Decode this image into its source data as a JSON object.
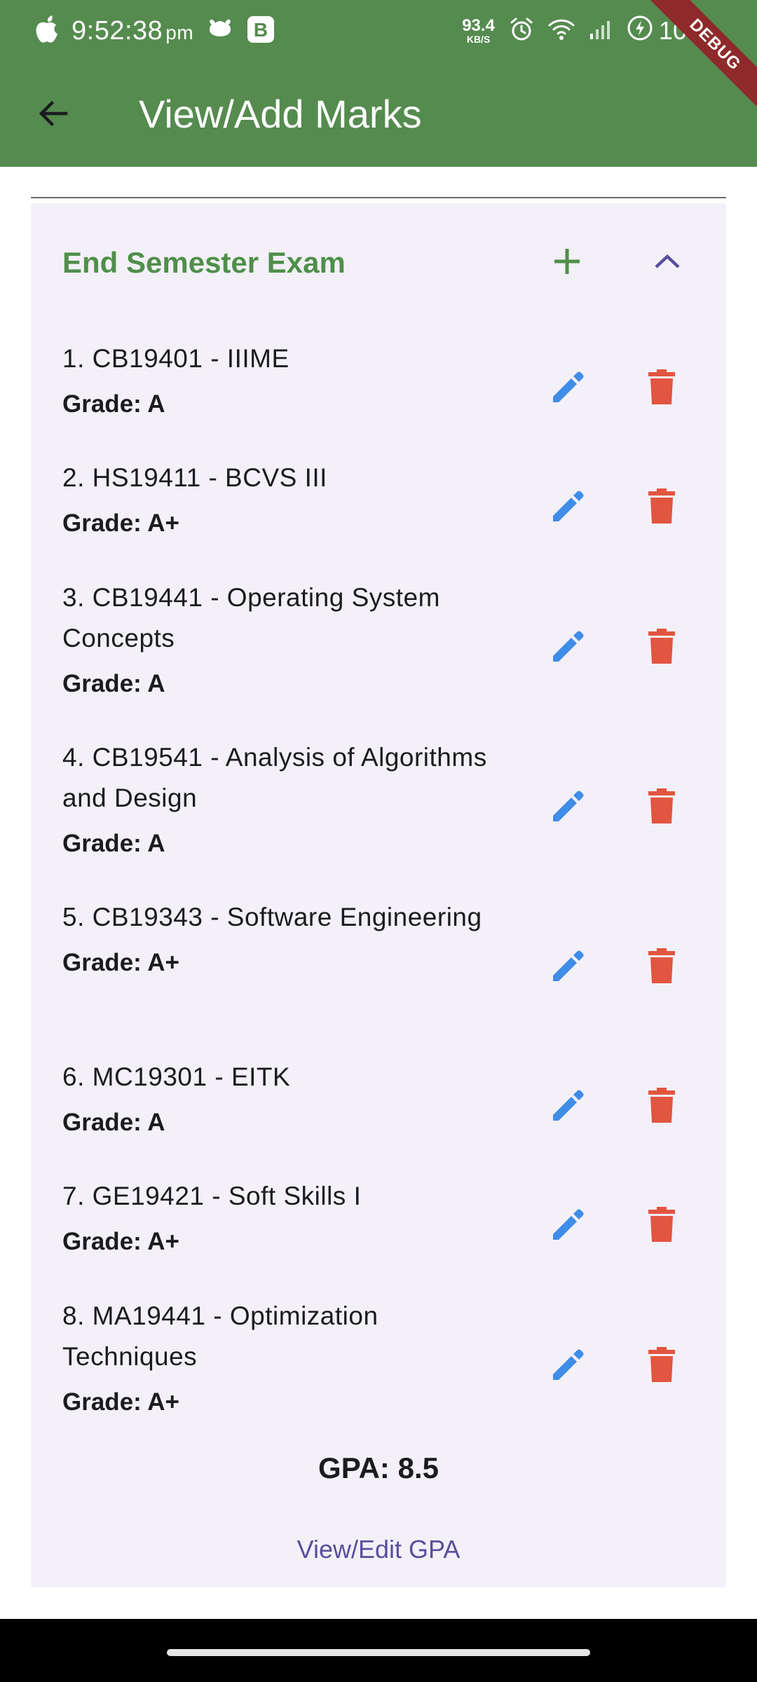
{
  "status_bar": {
    "time": "9:52:38",
    "ampm": "pm",
    "speed_value": "93.4",
    "speed_unit": "KB/S",
    "battery": "100",
    "debug_label": "DEBUG"
  },
  "app_bar": {
    "title": "View/Add Marks"
  },
  "section": {
    "title": "End Semester Exam"
  },
  "courses": [
    {
      "name": "1. CB19401 - IIIME",
      "grade": "Grade: A"
    },
    {
      "name": "2. HS19411 - BCVS III",
      "grade": "Grade: A+"
    },
    {
      "name": "3. CB19441 - Operating System Concepts",
      "grade": "Grade: A"
    },
    {
      "name": "4. CB19541 - Analysis of Algorithms and Design",
      "grade": "Grade: A"
    },
    {
      "name": "5. CB19343 - Software Engineering",
      "grade": "Grade: A+"
    },
    {
      "name": "6. MC19301 - EITK",
      "grade": "Grade: A"
    },
    {
      "name": "7. GE19421 - Soft Skills I",
      "grade": "Grade: A+"
    },
    {
      "name": "8. MA19441 - Optimization Techniques",
      "grade": "Grade: A+"
    }
  ],
  "gpa": {
    "text": "GPA: 8.5",
    "link_label": "View/Edit GPA"
  },
  "colors": {
    "header": "#558b4f",
    "section_title": "#4f8f4a",
    "edit_icon": "#3f8de8",
    "delete_icon": "#e25540",
    "link": "#5b4e9c"
  },
  "icons": {
    "back": "arrow-back-icon",
    "add": "plus-icon",
    "collapse": "chevron-up-icon",
    "edit": "pencil-icon",
    "delete": "trash-icon"
  }
}
